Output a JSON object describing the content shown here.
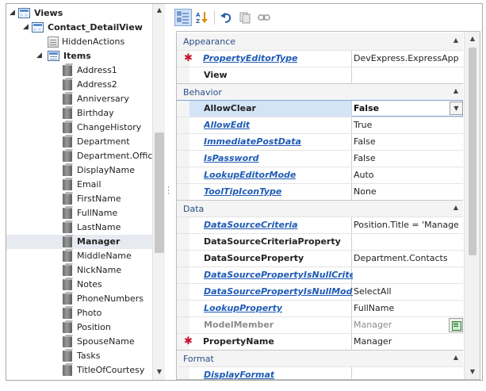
{
  "tree": {
    "root": {
      "label": "Views",
      "icon": "views-icon"
    },
    "detail_view": {
      "label": "Contact_DetailView",
      "icon": "detail-view-icon"
    },
    "hidden_actions": {
      "label": "HiddenActions",
      "icon": "hidden-actions-icon"
    },
    "items_node": {
      "label": "Items",
      "icon": "items-list-icon"
    },
    "items": [
      {
        "label": "Address1"
      },
      {
        "label": "Address2"
      },
      {
        "label": "Anniversary"
      },
      {
        "label": "Birthday"
      },
      {
        "label": "ChangeHistory"
      },
      {
        "label": "Department"
      },
      {
        "label": "Department.Office"
      },
      {
        "label": "DisplayName"
      },
      {
        "label": "Email"
      },
      {
        "label": "FirstName"
      },
      {
        "label": "FullName"
      },
      {
        "label": "LastName"
      },
      {
        "label": "Manager",
        "selected": true
      },
      {
        "label": "MiddleName"
      },
      {
        "label": "NickName"
      },
      {
        "label": "Notes"
      },
      {
        "label": "PhoneNumbers"
      },
      {
        "label": "Photo"
      },
      {
        "label": "Position"
      },
      {
        "label": "SpouseName"
      },
      {
        "label": "Tasks"
      },
      {
        "label": "TitleOfCourtesy"
      }
    ]
  },
  "toolbar": {
    "buttons": [
      {
        "icon": "categorized-icon",
        "pressed": true
      },
      {
        "icon": "sort-alphabetical-icon",
        "pressed": false
      },
      {
        "icon": "undo-icon",
        "pressed": false
      },
      {
        "icon": "copy-icon",
        "pressed": false
      },
      {
        "icon": "link-icon",
        "pressed": false
      }
    ]
  },
  "grid": {
    "categories": [
      {
        "label": "Appearance",
        "properties": [
          {
            "name": "PropertyEditorType",
            "value": "DevExpress.ExpressApp...",
            "style": "link",
            "required": true
          },
          {
            "name": "View",
            "value": "",
            "style": "plain"
          }
        ]
      },
      {
        "label": "Behavior",
        "properties": [
          {
            "name": "AllowClear",
            "value": "False",
            "style": "plain",
            "selected": true,
            "dropdown": true
          },
          {
            "name": "AllowEdit",
            "value": "True",
            "style": "link"
          },
          {
            "name": "ImmediatePostData",
            "value": "False",
            "style": "link"
          },
          {
            "name": "IsPassword",
            "value": "False",
            "style": "link"
          },
          {
            "name": "LookupEditorMode",
            "value": "Auto",
            "style": "link"
          },
          {
            "name": "ToolTipIconType",
            "value": "None",
            "style": "link"
          }
        ]
      },
      {
        "label": "Data",
        "properties": [
          {
            "name": "DataSourceCriteria",
            "value": "Position.Title = 'Manager'",
            "style": "link"
          },
          {
            "name": "DataSourceCriteriaProperty",
            "value": "",
            "style": "plain"
          },
          {
            "name": "DataSourceProperty",
            "value": "Department.Contacts",
            "style": "plain"
          },
          {
            "name": "DataSourcePropertyIsNullCriteria",
            "value": "",
            "style": "link"
          },
          {
            "name": "DataSourcePropertyIsNullMode",
            "value": "SelectAll",
            "style": "link"
          },
          {
            "name": "LookupProperty",
            "value": "FullName",
            "style": "link"
          },
          {
            "name": "ModelMember",
            "value": "Manager",
            "style": "dim",
            "edit_button": true
          },
          {
            "name": "PropertyName",
            "value": "Manager",
            "style": "plain",
            "required": true
          }
        ]
      },
      {
        "label": "Format",
        "properties": [
          {
            "name": "DisplayFormat",
            "value": "",
            "style": "link"
          }
        ]
      }
    ]
  },
  "colors": {
    "link": "#1f5bb5",
    "category_text": "#2b4f87",
    "required_marker": "#c8102e",
    "selection": "#d4e4f7",
    "tree_selection": "#e7ebf1"
  }
}
